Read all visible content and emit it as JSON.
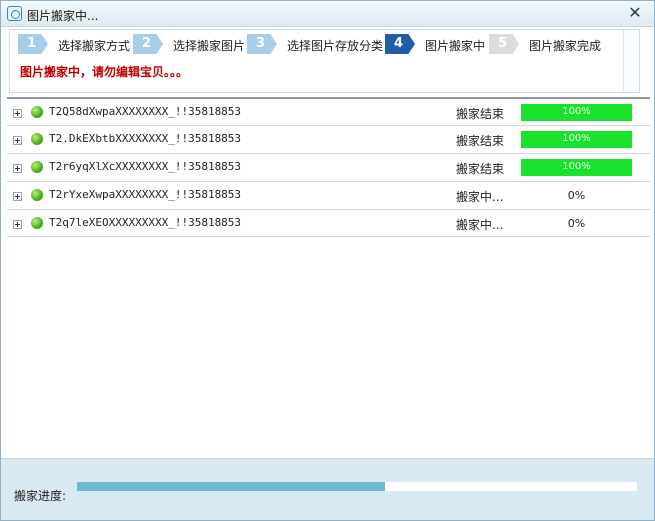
{
  "window": {
    "title": "图片搬家中..."
  },
  "steps": [
    {
      "num": "1",
      "label": "选择搬家方式",
      "state": "past"
    },
    {
      "num": "2",
      "label": "选择搬家图片",
      "state": "past"
    },
    {
      "num": "3",
      "label": "选择图片存放分类",
      "state": "past"
    },
    {
      "num": "4",
      "label": "图片搬家中",
      "state": "active"
    },
    {
      "num": "5",
      "label": "图片搬家完成",
      "state": "future"
    }
  ],
  "warning": "图片搬家中，请勿编辑宝贝。。。",
  "rows": [
    {
      "name": "T2Q58dXwpaXXXXXXXX_!!35818853",
      "status": "搬家结束",
      "progress": 100,
      "progress_text": "100%"
    },
    {
      "name": "T2.DkEXbtbXXXXXXXX_!!35818853",
      "status": "搬家结束",
      "progress": 100,
      "progress_text": "100%"
    },
    {
      "name": "T2r6yqXlXcXXXXXXXX_!!35818853",
      "status": "搬家结束",
      "progress": 100,
      "progress_text": "100%"
    },
    {
      "name": "T2rYxeXwpaXXXXXXXX_!!35818853",
      "status": "搬家中...",
      "progress": 0,
      "progress_text": "0%"
    },
    {
      "name": "T2q7leXEOXXXXXXXXX_!!35818853",
      "status": "搬家中...",
      "progress": 0,
      "progress_text": "0%"
    }
  ],
  "footer": {
    "progress_label": "搬家进度:",
    "overall_progress": 0.55
  },
  "colors": {
    "accent": "#1e5fa8",
    "bar_green": "#18e22c",
    "warning_red": "#c00000"
  }
}
